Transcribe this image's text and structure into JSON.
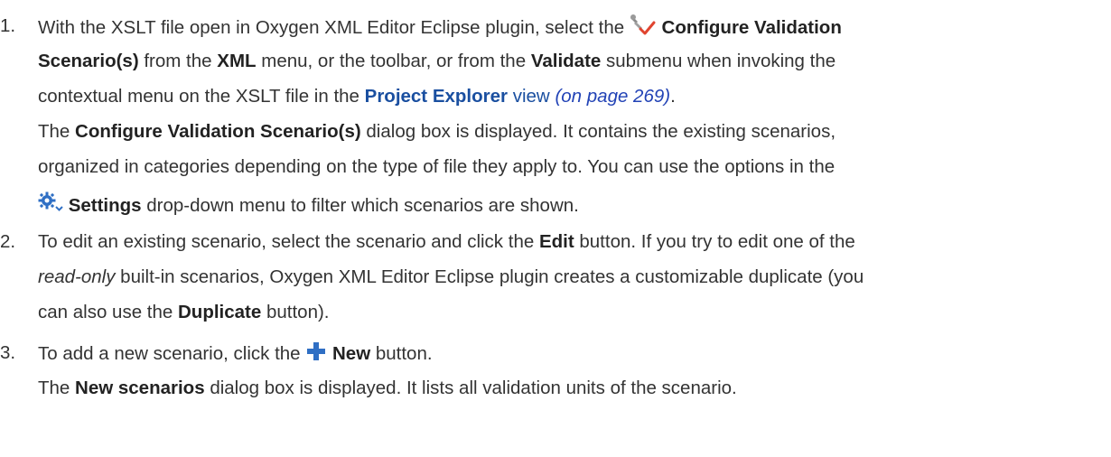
{
  "steps": [
    {
      "number": "1.",
      "line1_a": "With the XSLT file open in Oxygen XML Editor Eclipse plugin, select the",
      "line1_b": "Configure Validation",
      "line2_a": "Scenario(s)",
      "line2_b": "from the",
      "line2_c": "XML",
      "line2_d": "menu, or the toolbar, or from the",
      "line2_e": "Validate",
      "line2_f": "submenu when invoking the",
      "line3_a": "contextual menu on the XSLT file in the",
      "line3_b": "Project Explorer",
      "line3_c": "view",
      "line3_d": "(on page 269)",
      "line3_e": ".",
      "line4_a": "The",
      "line4_b": "Configure Validation Scenario(s)",
      "line4_c": "dialog box is displayed. It contains the existing scenarios,",
      "line5": "organized in categories depending on the type of file they apply to. You can use the options in the",
      "line6_a": "Settings",
      "line6_b": "drop-down menu to filter which scenarios are shown."
    },
    {
      "number": "2.",
      "line1_a": "To edit an existing scenario, select the scenario and click the",
      "line1_b": "Edit",
      "line1_c": "button. If you try to edit one of the",
      "line2_a": "read-only",
      "line2_b": "built-in scenarios, Oxygen XML Editor Eclipse plugin creates a customizable duplicate (you",
      "line3_a": "can also use the",
      "line3_b": "Duplicate",
      "line3_c": "button)."
    },
    {
      "number": "3.",
      "line1_a": "To add a new scenario, click the",
      "line1_b": "New",
      "line1_c": "button.",
      "line2_a": "The",
      "line2_b": "New scenarios",
      "line2_c": "dialog box is displayed. It lists all validation units of the scenario."
    }
  ]
}
